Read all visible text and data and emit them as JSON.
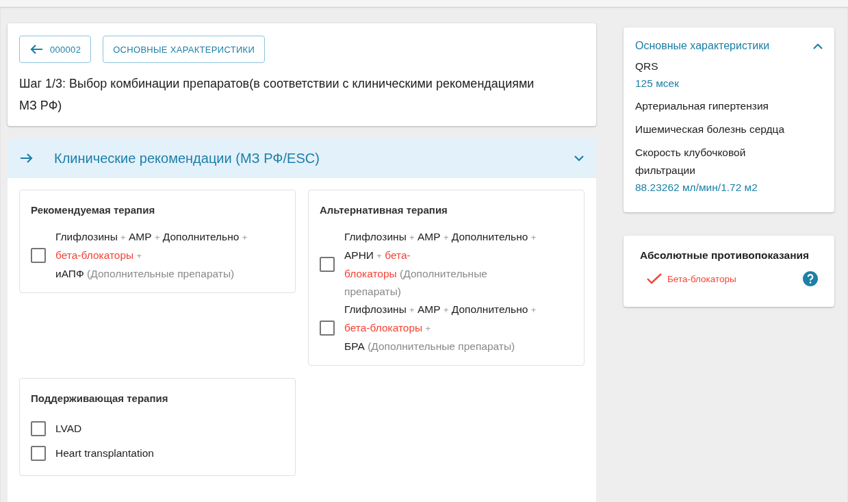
{
  "header": {
    "back_button": "000002",
    "tab_button": "ОСНОВНЫЕ ХАРАКТЕРИСТИКИ",
    "title": "Шаг 1/3: Выбор комбинации препаратов(в соответствии с клиническими рекомендациями МЗ РФ)"
  },
  "accordion": {
    "title": "Клинические рекомендации (МЗ РФ/ESC)",
    "expanded": true,
    "groups": [
      {
        "title": "Рекомендуемая терапия",
        "options": [
          {
            "checked": false,
            "lines": [
              [
                {
                  "kind": "drug",
                  "text": "Глифлозины"
                },
                {
                  "kind": "plus",
                  "text": "+"
                },
                {
                  "kind": "drug",
                  "text": "АМР"
                },
                {
                  "kind": "plus",
                  "text": "+"
                },
                {
                  "kind": "drug",
                  "text": "Дополнительно"
                },
                {
                  "kind": "plus",
                  "text": "+"
                }
              ],
              [
                {
                  "kind": "warn",
                  "text": "бета-блокаторы"
                },
                {
                  "kind": "plus",
                  "text": "+"
                }
              ],
              [
                {
                  "kind": "drug",
                  "text": "иАПФ"
                },
                {
                  "kind": "note",
                  "text": "(Дополнительные препараты)"
                }
              ]
            ]
          }
        ]
      },
      {
        "title": "Альтернативная терапия",
        "options": [
          {
            "checked": false,
            "lines": [
              [
                {
                  "kind": "drug",
                  "text": "Глифлозины"
                },
                {
                  "kind": "plus",
                  "text": "+"
                },
                {
                  "kind": "drug",
                  "text": "АМР"
                },
                {
                  "kind": "plus",
                  "text": "+"
                },
                {
                  "kind": "drug",
                  "text": "Дополнительно"
                },
                {
                  "kind": "plus",
                  "text": "+"
                }
              ],
              [
                {
                  "kind": "drug",
                  "text": "АРНИ"
                },
                {
                  "kind": "plus",
                  "text": "+"
                },
                {
                  "kind": "warn",
                  "text": "бета-"
                }
              ],
              [
                {
                  "kind": "warn",
                  "text": "блокаторы"
                },
                {
                  "kind": "note",
                  "text": "(Дополнительные"
                }
              ],
              [
                {
                  "kind": "note",
                  "text": "препараты)"
                }
              ]
            ]
          },
          {
            "checked": false,
            "lines": [
              [
                {
                  "kind": "drug",
                  "text": "Глифлозины"
                },
                {
                  "kind": "plus",
                  "text": "+"
                },
                {
                  "kind": "drug",
                  "text": "АМР"
                },
                {
                  "kind": "plus",
                  "text": "+"
                },
                {
                  "kind": "drug",
                  "text": "Дополнительно"
                },
                {
                  "kind": "plus",
                  "text": "+"
                }
              ],
              [
                {
                  "kind": "warn",
                  "text": "бета-блокаторы"
                },
                {
                  "kind": "plus",
                  "text": "+"
                }
              ],
              [
                {
                  "kind": "drug",
                  "text": "БРА"
                },
                {
                  "kind": "note",
                  "text": "(Дополнительные препараты)"
                }
              ]
            ]
          }
        ]
      },
      {
        "title": "Поддерживающая терапия",
        "options": [
          {
            "checked": false,
            "lines": [
              [
                {
                  "kind": "drug",
                  "text": "LVAD"
                }
              ]
            ]
          },
          {
            "checked": false,
            "lines": [
              [
                {
                  "kind": "drug",
                  "text": "Heart transplantation"
                }
              ]
            ]
          }
        ]
      }
    ]
  },
  "characteristics": {
    "title": "Основные характеристики",
    "expanded": true,
    "items": [
      {
        "label": "QRS",
        "value": "125 мсек"
      },
      {
        "label": "Артериальная гипертензия"
      },
      {
        "label": "Ишемическая болезнь сердца"
      },
      {
        "label": "Скорость клубочковой фильтрации",
        "value": "88.23262 мл/мин/1.72 м2"
      }
    ]
  },
  "contraindications": {
    "title": "Абсолютные противопоказания",
    "items": [
      {
        "text": "Бета-блокаторы"
      }
    ]
  }
}
